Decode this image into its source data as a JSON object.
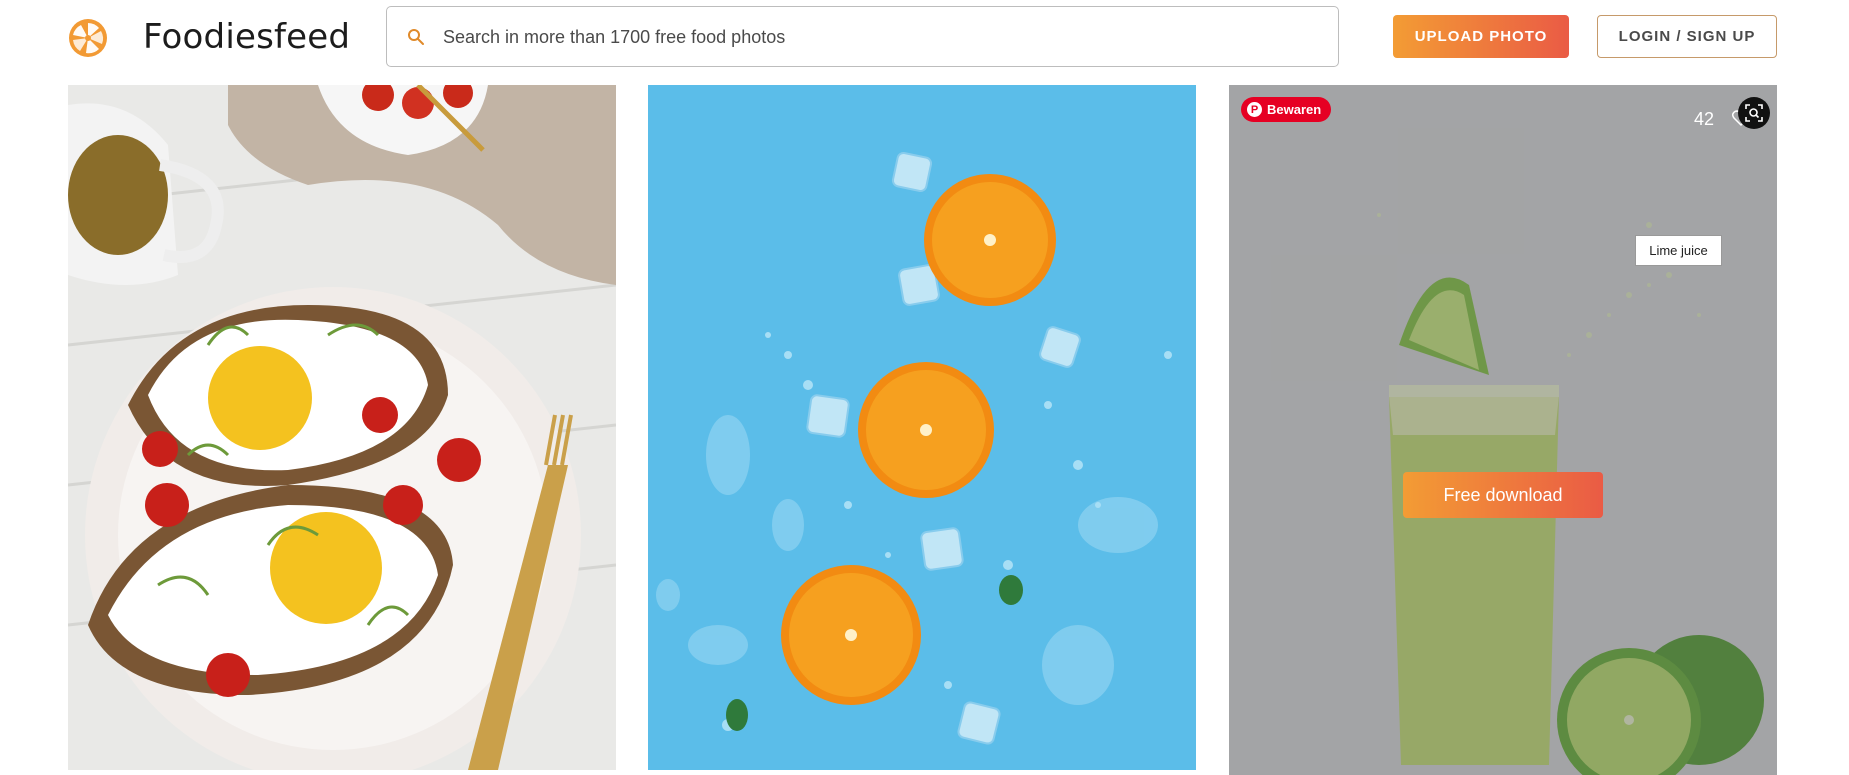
{
  "header": {
    "brand": "Foodiesfeed",
    "search_placeholder": "Search in more than 1700 free food photos",
    "upload_label": "UPLOAD PHOTO",
    "login_label": "LOGIN / SIGN UP"
  },
  "cards": [
    {
      "subject": "avocado toast with fried eggs and tomatoes",
      "icon": "photo-image"
    },
    {
      "subject": "orange slices with ice cubes on blue background",
      "icon": "photo-image"
    },
    {
      "subject": "lime juice in a glass with limes",
      "pin_label": "Bewaren",
      "likes": "42",
      "tooltip": "Lime juice",
      "download_label": "Free download"
    }
  ],
  "colors": {
    "accent_start": "#f39c34",
    "accent_end": "#ea5b45",
    "pinterest": "#e60023",
    "card2_background": "#5bbde9",
    "card3_background": "#9a9ca0"
  },
  "icons": [
    "logo-icon",
    "search-icon",
    "pinterest-icon",
    "heart-icon",
    "lens-icon"
  ]
}
